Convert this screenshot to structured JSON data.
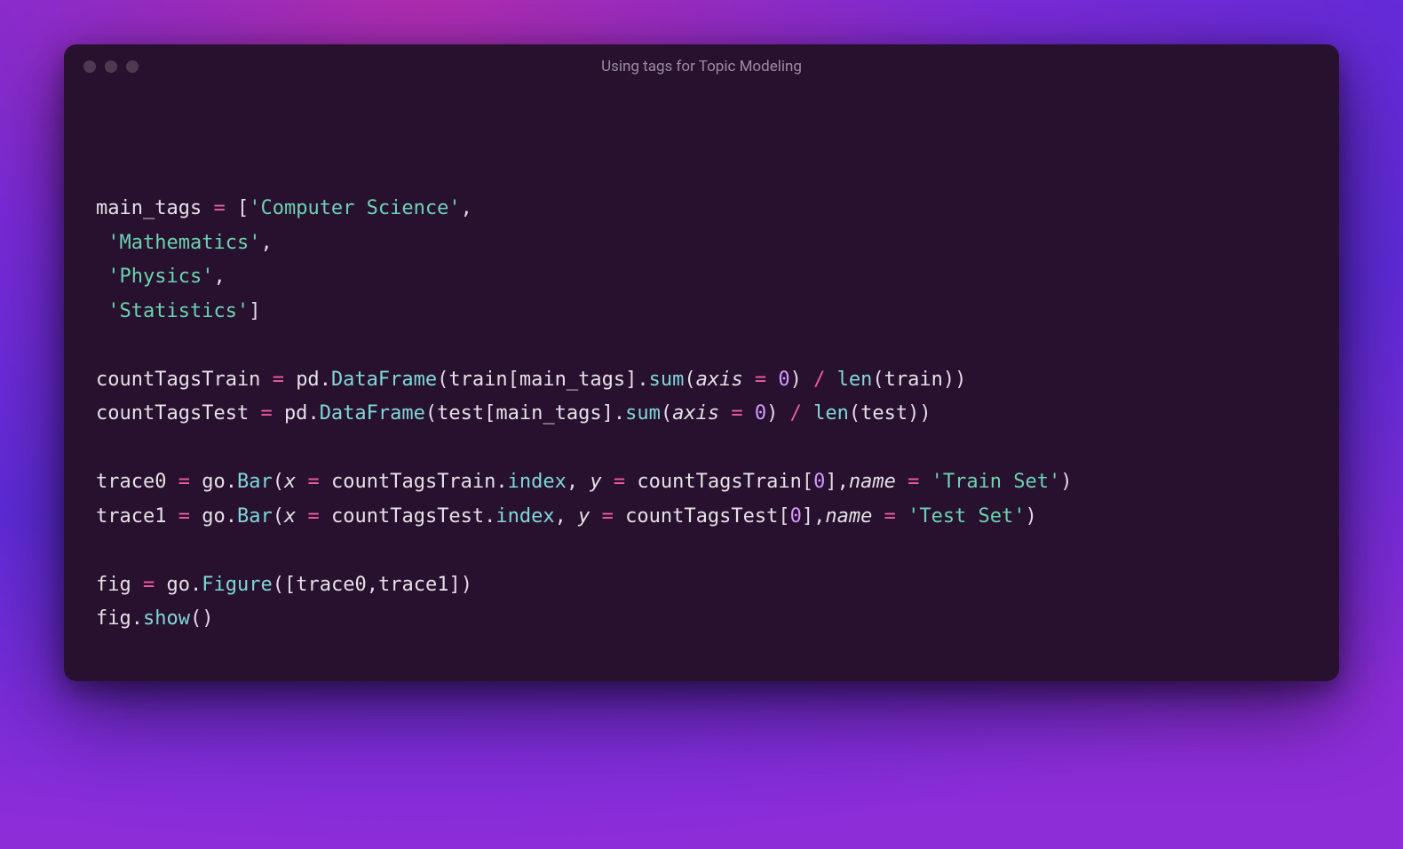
{
  "window": {
    "title": "Using tags for Topic Modeling"
  },
  "code": {
    "line1_var": "main_tags",
    "line1_eq": "=",
    "line1_open": "[",
    "line1_s1": "'Computer Science'",
    "line1_c": ",",
    "line2_s": "'Mathematics'",
    "line2_c": ",",
    "line3_s": "'Physics'",
    "line3_c": ",",
    "line4_s": "'Statistics'",
    "line4_close": "]",
    "l6_var": "countTagsTrain",
    "l6_eq": "=",
    "l6_pd": "pd",
    "l6_dot1": ".",
    "l6_df": "DataFrame",
    "l6_op1": "(",
    "l6_train": "train",
    "l6_ob": "[",
    "l6_mt": "main_tags",
    "l6_cb": "]",
    "l6_dot2": ".",
    "l6_sum": "sum",
    "l6_op2": "(",
    "l6_axis": "axis",
    "l6_eq2": "=",
    "l6_zero": "0",
    "l6_cp2": ")",
    "l6_div": "/",
    "l6_len": "len",
    "l6_op3": "(",
    "l6_train2": "train",
    "l6_cp3": "))",
    "l7_var": "countTagsTest",
    "l7_eq": "=",
    "l7_pd": "pd",
    "l7_dot1": ".",
    "l7_df": "DataFrame",
    "l7_op1": "(",
    "l7_test": "test",
    "l7_ob": "[",
    "l7_mt": "main_tags",
    "l7_cb": "]",
    "l7_dot2": ".",
    "l7_sum": "sum",
    "l7_op2": "(",
    "l7_axis": "axis",
    "l7_eq2": "=",
    "l7_zero": "0",
    "l7_cp2": ")",
    "l7_div": "/",
    "l7_len": "len",
    "l7_op3": "(",
    "l7_test2": "test",
    "l7_cp3": "))",
    "l9_var": "trace0",
    "l9_eq": "=",
    "l9_go": "go",
    "l9_dot": ".",
    "l9_bar": "Bar",
    "l9_op": "(",
    "l9_x": "x",
    "l9_eq2": "=",
    "l9_ctt": "countTagsTrain",
    "l9_dot2": ".",
    "l9_idx": "index",
    "l9_c1": ",",
    "l9_y": "y",
    "l9_eq3": "=",
    "l9_ctt2": "countTagsTrain",
    "l9_ob": "[",
    "l9_zero": "0",
    "l9_cb": "]",
    "l9_c2": ",",
    "l9_name": "name",
    "l9_eq4": "=",
    "l9_s": "'Train Set'",
    "l9_cp": ")",
    "l10_var": "trace1",
    "l10_eq": "=",
    "l10_go": "go",
    "l10_dot": ".",
    "l10_bar": "Bar",
    "l10_op": "(",
    "l10_x": "x",
    "l10_eq2": "=",
    "l10_ctt": "countTagsTest",
    "l10_dot2": ".",
    "l10_idx": "index",
    "l10_c1": ",",
    "l10_y": "y",
    "l10_eq3": "=",
    "l10_ctt2": "countTagsTest",
    "l10_ob": "[",
    "l10_zero": "0",
    "l10_cb": "]",
    "l10_c2": ",",
    "l10_name": "name",
    "l10_eq4": "=",
    "l10_s": "'Test Set'",
    "l10_cp": ")",
    "l12_var": "fig",
    "l12_eq": "=",
    "l12_go": "go",
    "l12_dot": ".",
    "l12_fig": "Figure",
    "l12_op": "([",
    "l12_t0": "trace0",
    "l12_c": ",",
    "l12_t1": "trace1",
    "l12_cp": "])",
    "l13_fig": "fig",
    "l13_dot": ".",
    "l13_show": "show",
    "l13_p": "()"
  }
}
